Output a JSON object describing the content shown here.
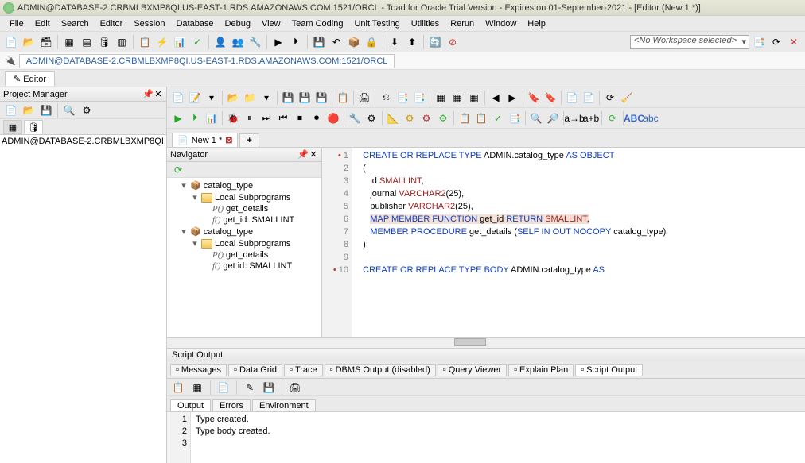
{
  "title": "ADMIN@DATABASE-2.CRBMLBXMP8QI.US-EAST-1.RDS.AMAZONAWS.COM:1521/ORCL - Toad for Oracle Trial Version - Expires on 01-September-2021 - [Editor (New 1 *)]",
  "menu": [
    "File",
    "Edit",
    "Search",
    "Editor",
    "Session",
    "Database",
    "Debug",
    "View",
    "Team Coding",
    "Unit Testing",
    "Utilities",
    "Rerun",
    "Window",
    "Help"
  ],
  "workspace_selected": "<No Workspace selected>",
  "connection_tab": "ADMIN@DATABASE-2.CRBMLBXMP8QI.US-EAST-1.RDS.AMAZONAWS.COM:1521/ORCL",
  "editor_label": "Editor",
  "project_manager": {
    "title": "Project Manager",
    "connection": "ADMIN@DATABASE-2.CRBMLBXMP8QI."
  },
  "sql_tab": "New 1 *",
  "navigator": {
    "title": "Navigator",
    "tree": [
      {
        "level": 1,
        "exp": "▾",
        "icon": "type",
        "label": "catalog_type"
      },
      {
        "level": 2,
        "exp": "▾",
        "icon": "folder",
        "label": "Local Subprograms"
      },
      {
        "level": 3,
        "exp": "",
        "icon": "proc",
        "label": "get_details"
      },
      {
        "level": 3,
        "exp": "",
        "icon": "func",
        "label": "get_id: SMALLINT"
      },
      {
        "level": 1,
        "exp": "▾",
        "icon": "typebody",
        "label": "catalog_type"
      },
      {
        "level": 2,
        "exp": "▾",
        "icon": "folder",
        "label": "Local Subprograms"
      },
      {
        "level": 3,
        "exp": "",
        "icon": "proc",
        "label": "get_details"
      },
      {
        "level": 3,
        "exp": "",
        "icon": "func",
        "label": "get id: SMALLINT"
      }
    ]
  },
  "code": {
    "lines": [
      {
        "n": 1,
        "mark": "·",
        "html": "<span class='kw'>CREATE OR REPLACE TYPE</span> ADMIN.catalog_type <span class='kw'>AS OBJECT</span>"
      },
      {
        "n": 2,
        "mark": "",
        "html": "("
      },
      {
        "n": 3,
        "mark": "",
        "html": "   id <span class='typ'>SMALLINT</span>,"
      },
      {
        "n": 4,
        "mark": "",
        "html": "   journal <span class='typ'>VARCHAR2</span>(25),"
      },
      {
        "n": 5,
        "mark": "",
        "html": "   publisher <span class='typ'>VARCHAR2</span>(25),"
      },
      {
        "n": 6,
        "mark": "",
        "html": "   <span class='hl'><span class='kw'>MAP MEMBER FUNCTION</span> get_id <span class='kw'>RETURN</span> <span class='typ'>SMALLINT</span>,</span>"
      },
      {
        "n": 7,
        "mark": "",
        "html": "   <span class='kw'>MEMBER PROCEDURE</span> get_details (<span class='kw'>SELF IN OUT NOCOPY</span> catalog_type)"
      },
      {
        "n": 8,
        "mark": "",
        "html": ");"
      },
      {
        "n": 9,
        "mark": "",
        "html": ""
      },
      {
        "n": 10,
        "mark": "·",
        "html": "<span class='kw'>CREATE OR REPLACE TYPE BODY</span> ADMIN.catalog_type <span class='kw'>AS</span>"
      }
    ]
  },
  "script_output": {
    "title": "Script Output",
    "upper_tabs": [
      "Messages",
      "Data Grid",
      "Trace",
      "DBMS Output (disabled)",
      "Query Viewer",
      "Explain Plan",
      "Script Output"
    ],
    "active_upper": "Script Output",
    "lower_tabs": [
      "Output",
      "Errors",
      "Environment"
    ],
    "active_lower": "Output",
    "rows": [
      {
        "n": 1,
        "text": "Type created."
      },
      {
        "n": 2,
        "text": "Type body created."
      },
      {
        "n": 3,
        "text": " "
      }
    ]
  }
}
